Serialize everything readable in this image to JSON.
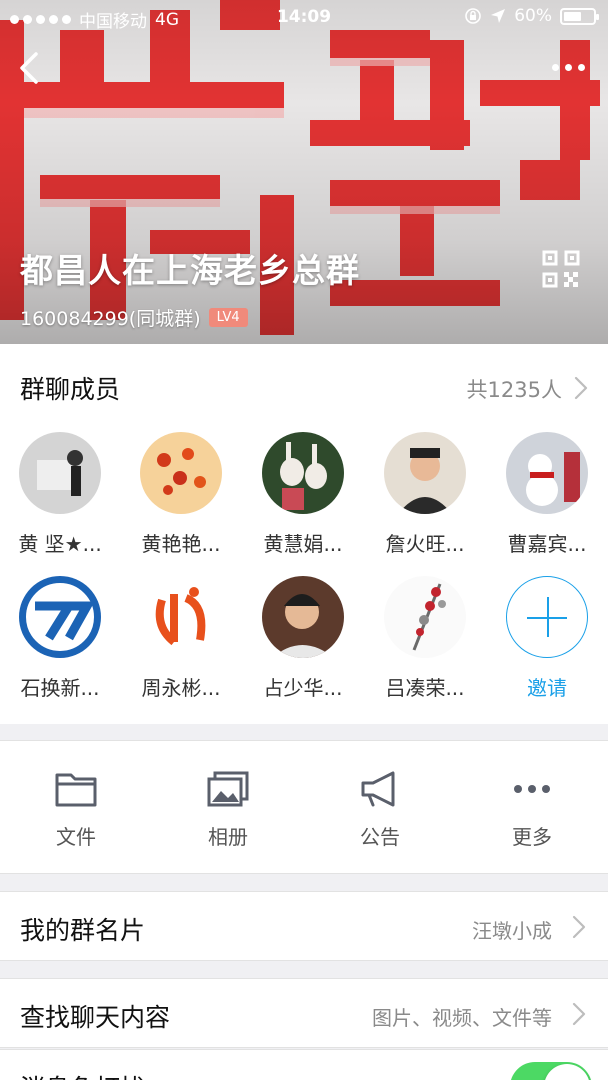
{
  "status_bar": {
    "carrier": "中国移动",
    "network": "4G",
    "time": "14:09",
    "battery": "60%",
    "battery_level": 0.6
  },
  "header": {
    "group_name": "都昌人在上海老乡总群",
    "group_id": "160084299(同城群)",
    "level_badge": "LV4",
    "background_color": "#e8e8e8",
    "accent_color": "#e02020"
  },
  "members": {
    "title": "群聊成员",
    "count": "共1235人",
    "list": [
      {
        "name": "黄 坚★...",
        "color": "#c9c9c9"
      },
      {
        "name": "黄艳艳...",
        "color": "#f3c27a"
      },
      {
        "name": "黄慧娟...",
        "color": "#3b5b3a"
      },
      {
        "name": "詹火旺...",
        "color": "#d9d2c6"
      },
      {
        "name": "曹嘉宾...",
        "color": "#c8ccd4"
      },
      {
        "name": "石换新...",
        "color": "#1b63b5"
      },
      {
        "name": "周永彬...",
        "color": "#e8501c"
      },
      {
        "name": "占少华...",
        "color": "#6b3b2a"
      },
      {
        "name": "吕凑荣...",
        "color": "#f4f4f4"
      }
    ],
    "invite_label": "邀请"
  },
  "tools": [
    {
      "label": "文件",
      "icon": "folder-icon"
    },
    {
      "label": "相册",
      "icon": "photo-album-icon"
    },
    {
      "label": "公告",
      "icon": "megaphone-icon"
    },
    {
      "label": "更多",
      "icon": "more-dots-icon"
    }
  ],
  "rows": {
    "card": {
      "label": "我的群名片",
      "value": "汪墩小成"
    },
    "search": {
      "label": "查找聊天内容",
      "value": "图片、视频、文件等"
    },
    "mute": {
      "label": "消息免打扰",
      "enabled": true
    }
  },
  "colors": {
    "link_blue": "#1aa0e8",
    "toggle_green": "#4cd964",
    "badge_red": "#f08a7b"
  }
}
